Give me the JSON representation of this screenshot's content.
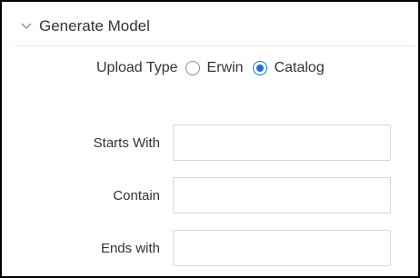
{
  "section": {
    "title": "Generate Model",
    "collapse_icon": "chevron-down-icon"
  },
  "upload_type": {
    "label": "Upload Type",
    "options": [
      {
        "label": "Erwin",
        "selected": false
      },
      {
        "label": "Catalog",
        "selected": true
      }
    ],
    "accent_color": "#1a6fd6"
  },
  "fields": {
    "starts_with": {
      "label": "Starts With",
      "value": ""
    },
    "contain": {
      "label": "Contain",
      "value": ""
    },
    "ends_with": {
      "label": "Ends with",
      "value": ""
    }
  }
}
